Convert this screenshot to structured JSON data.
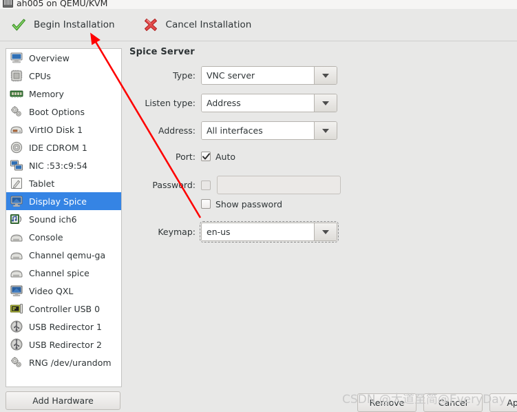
{
  "window": {
    "title": "ah005 on QEMU/KVM",
    "icon": "computer-icon"
  },
  "toolbar": {
    "begin_label": "Begin Installation",
    "begin_icon": "green-check-icon",
    "cancel_label": "Cancel Installation",
    "cancel_icon": "red-cross-icon"
  },
  "sidebar": {
    "items": [
      {
        "label": "Overview",
        "icon": "monitor-icon",
        "selected": false
      },
      {
        "label": "CPUs",
        "icon": "cpu-icon",
        "selected": false
      },
      {
        "label": "Memory",
        "icon": "memory-icon",
        "selected": false
      },
      {
        "label": "Boot Options",
        "icon": "gears-icon",
        "selected": false
      },
      {
        "label": "VirtIO Disk 1",
        "icon": "disk-icon",
        "selected": false
      },
      {
        "label": "IDE CDROM 1",
        "icon": "cdrom-icon",
        "selected": false
      },
      {
        "label": "NIC :53:c9:54",
        "icon": "network-icon",
        "selected": false
      },
      {
        "label": "Tablet",
        "icon": "tablet-icon",
        "selected": false
      },
      {
        "label": "Display Spice",
        "icon": "display-icon",
        "selected": true
      },
      {
        "label": "Sound ich6",
        "icon": "sound-icon",
        "selected": false
      },
      {
        "label": "Console",
        "icon": "console-icon",
        "selected": false
      },
      {
        "label": "Channel qemu-ga",
        "icon": "console-icon",
        "selected": false
      },
      {
        "label": "Channel spice",
        "icon": "console-icon",
        "selected": false
      },
      {
        "label": "Video QXL",
        "icon": "display-icon",
        "selected": false
      },
      {
        "label": "Controller USB 0",
        "icon": "controller-icon",
        "selected": false
      },
      {
        "label": "USB Redirector 1",
        "icon": "usb-icon",
        "selected": false
      },
      {
        "label": "USB Redirector 2",
        "icon": "usb-icon",
        "selected": false
      },
      {
        "label": "RNG /dev/urandom",
        "icon": "gears-icon",
        "selected": false
      }
    ],
    "add_hardware_label": "Add Hardware"
  },
  "panel": {
    "title": "Spice Server",
    "fields": {
      "type": {
        "label": "Type:",
        "value": "VNC server"
      },
      "listen_type": {
        "label": "Listen type:",
        "value": "Address"
      },
      "address": {
        "label": "Address:",
        "value": "All interfaces"
      },
      "port": {
        "label": "Port:",
        "checkbox_label": "Auto",
        "checked": true
      },
      "password": {
        "label": "Password:",
        "value": "",
        "checked": false,
        "enabled": false
      },
      "show_password": {
        "label": "Show password",
        "checked": false
      },
      "keymap": {
        "label": "Keymap:",
        "value": "en-us",
        "focused": true
      }
    }
  },
  "footer": {
    "remove_label": "Remove",
    "cancel_label": "Cancel",
    "apply_label": "Apply"
  },
  "annotation": {
    "watermark": "CSDN @大道至简@EveryDay",
    "arrow_color": "#fe0000"
  }
}
